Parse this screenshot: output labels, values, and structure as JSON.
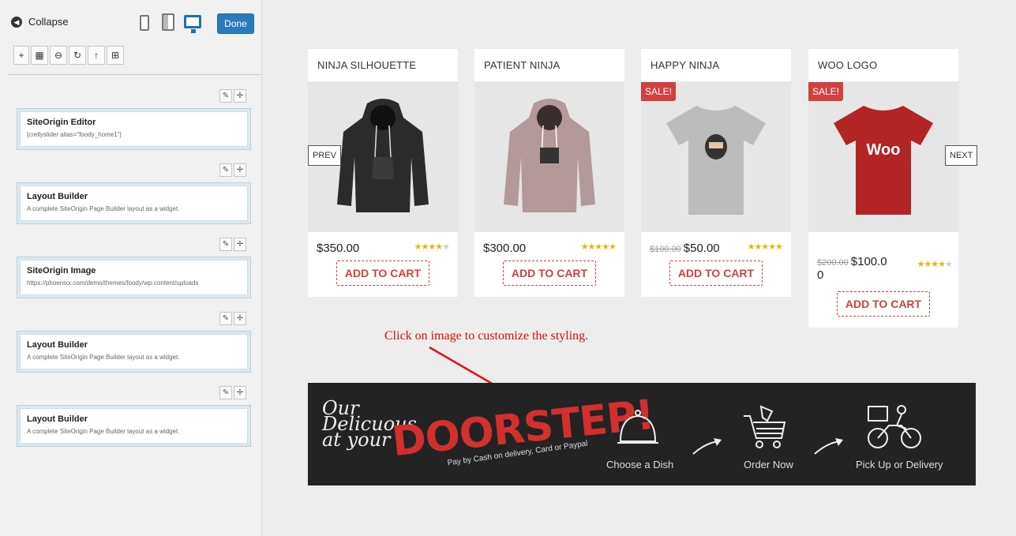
{
  "sidebar": {
    "collapse_label": "Collapse",
    "done_label": "Done",
    "toolbar": [
      {
        "name": "add-widget-tool",
        "glyph": "+"
      },
      {
        "name": "add-row-tool",
        "glyph": "▦"
      },
      {
        "name": "prebuilt-layout-tool",
        "glyph": "⊖"
      },
      {
        "name": "history-tool",
        "glyph": "↻"
      },
      {
        "name": "move-up-tool",
        "glyph": "↑"
      },
      {
        "name": "live-editor-tool",
        "glyph": "⊞"
      }
    ],
    "widgets": [
      {
        "title": "SiteOrigin Editor",
        "desc": "[crellyslider alias=\"foody_home1\"]"
      },
      {
        "title": "Layout Builder",
        "desc": "A complete SiteOrigin Page Builder layout as a widget."
      },
      {
        "title": "SiteOrigin Image",
        "desc": "https://phoenixx.com/demo/themes/foody/wp-content/uploads"
      },
      {
        "title": "Layout Builder",
        "desc": "A complete SiteOrigin Page Builder layout as a widget."
      },
      {
        "title": "Layout Builder",
        "desc": "A complete SiteOrigin Page Builder layout as a widget."
      }
    ]
  },
  "products": [
    {
      "name": "NINJA SILHOUETTE",
      "price": "$350.00",
      "old_price": "",
      "sale": "",
      "rating": 4,
      "cart_label": "ADD TO CART",
      "color": "#2b2b2b"
    },
    {
      "name": "PATIENT NINJA",
      "price": "$300.00",
      "old_price": "",
      "sale": "",
      "rating": 5,
      "cart_label": "ADD TO CART",
      "color": "#b89d9d"
    },
    {
      "name": "HAPPY NINJA",
      "price": "$50.00",
      "old_price": "$100.00",
      "sale": "SALE!",
      "rating": 5,
      "cart_label": "ADD TO CART",
      "color": "#bdbdbd"
    },
    {
      "name": "WOO LOGO",
      "price": "$100.0\n0",
      "old_price": "$200.00",
      "sale": "SALE!",
      "rating": 4,
      "cart_label": "ADD TO CART",
      "color": "#b02020"
    }
  ],
  "carousel": {
    "prev_label": "PREV",
    "next_label": "NEXT"
  },
  "hint": "Click on image to customize the styling.",
  "banner": {
    "line1": "Our",
    "line2": "Delicuous",
    "line3": "at your",
    "headline": "DOORSTEP!",
    "tagline": "Pay by Cash on delivery, Card or Paypal",
    "steps": [
      "Choose a Dish",
      "Order Now",
      "Pick Up or Delivery"
    ]
  },
  "colors": {
    "accent": "#d14040",
    "done": "#2a7bbd",
    "hint": "#d10f0f",
    "star": "#e8b400"
  }
}
